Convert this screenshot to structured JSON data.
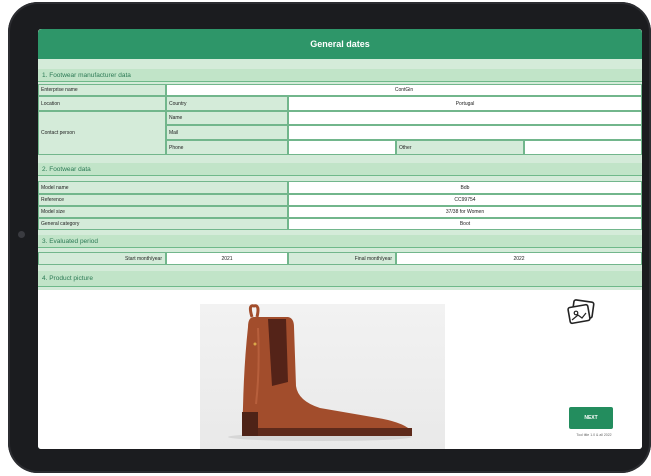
{
  "header": {
    "title": "General dates"
  },
  "section1": {
    "title": "1. Footwear manufacturer data",
    "enterprise_label": "Enterprise name",
    "enterprise_value": "ContGin",
    "location_label": "Location",
    "country_label": "Country",
    "country_value": "Portugal",
    "contact_label": "Contact person",
    "name_label": "Name",
    "mail_label": "Mail",
    "phone_label": "Phone",
    "other_label": "Other"
  },
  "section2": {
    "title": "2. Footwear data",
    "model_name_label": "Model name",
    "model_name_value": "Bdb",
    "reference_label": "Reference",
    "reference_value": "CC99754",
    "model_size_label": "Model size",
    "model_size_value": "37/38 for Women",
    "category_label": "General category",
    "category_value": "Boot"
  },
  "section3": {
    "title": "3. Evaluated period",
    "start_label": "Start month/year",
    "start_value": "2021",
    "final_label": "Final month/year",
    "final_value": "2022"
  },
  "section4": {
    "title": "4. Product picture"
  },
  "actions": {
    "next_label": "NEXT",
    "footer_note": "Tool title 1.0 & all 2022"
  }
}
